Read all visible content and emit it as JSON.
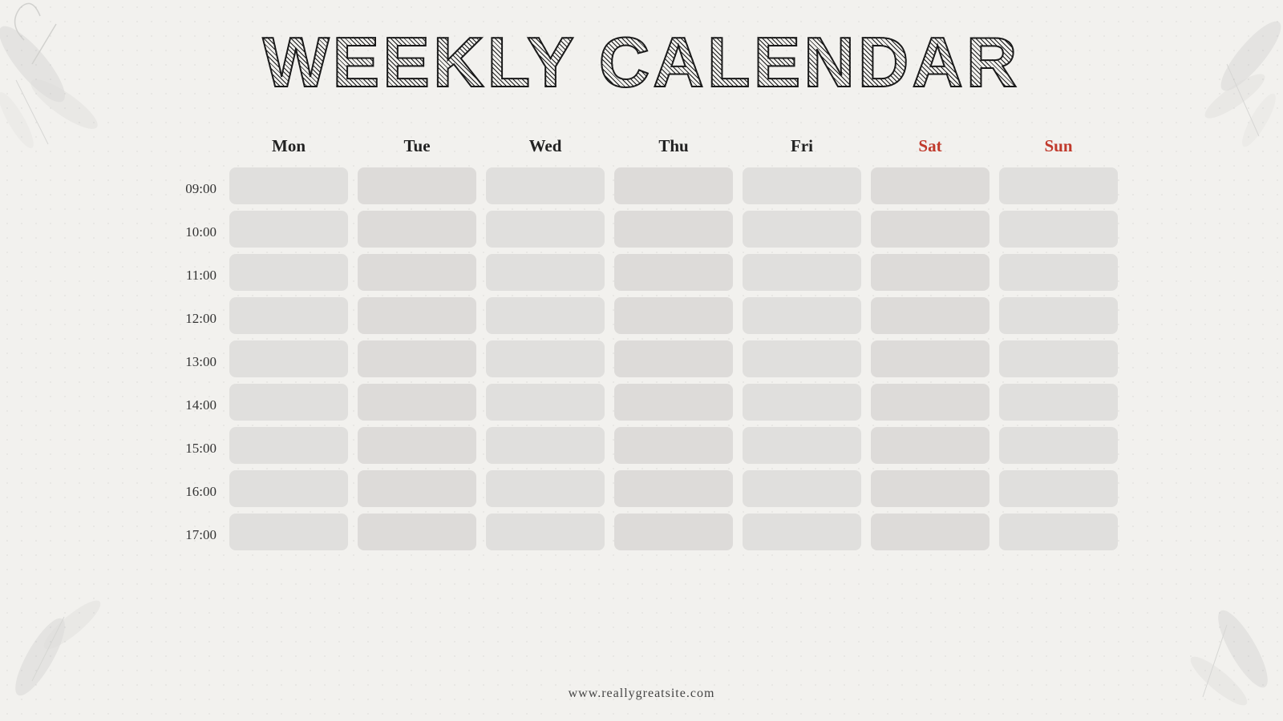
{
  "title": "WEEKLY CALENDAR",
  "days": [
    {
      "label": "Mon",
      "weekend": false
    },
    {
      "label": "Tue",
      "weekend": false
    },
    {
      "label": "Wed",
      "weekend": false
    },
    {
      "label": "Thu",
      "weekend": false
    },
    {
      "label": "Fri",
      "weekend": false
    },
    {
      "label": "Sat",
      "weekend": true
    },
    {
      "label": "Sun",
      "weekend": true
    }
  ],
  "times": [
    "09:00",
    "10:00",
    "11:00",
    "12:00",
    "13:00",
    "14:00",
    "15:00",
    "16:00",
    "17:00"
  ],
  "footer": "www.reallygreatsite.com"
}
